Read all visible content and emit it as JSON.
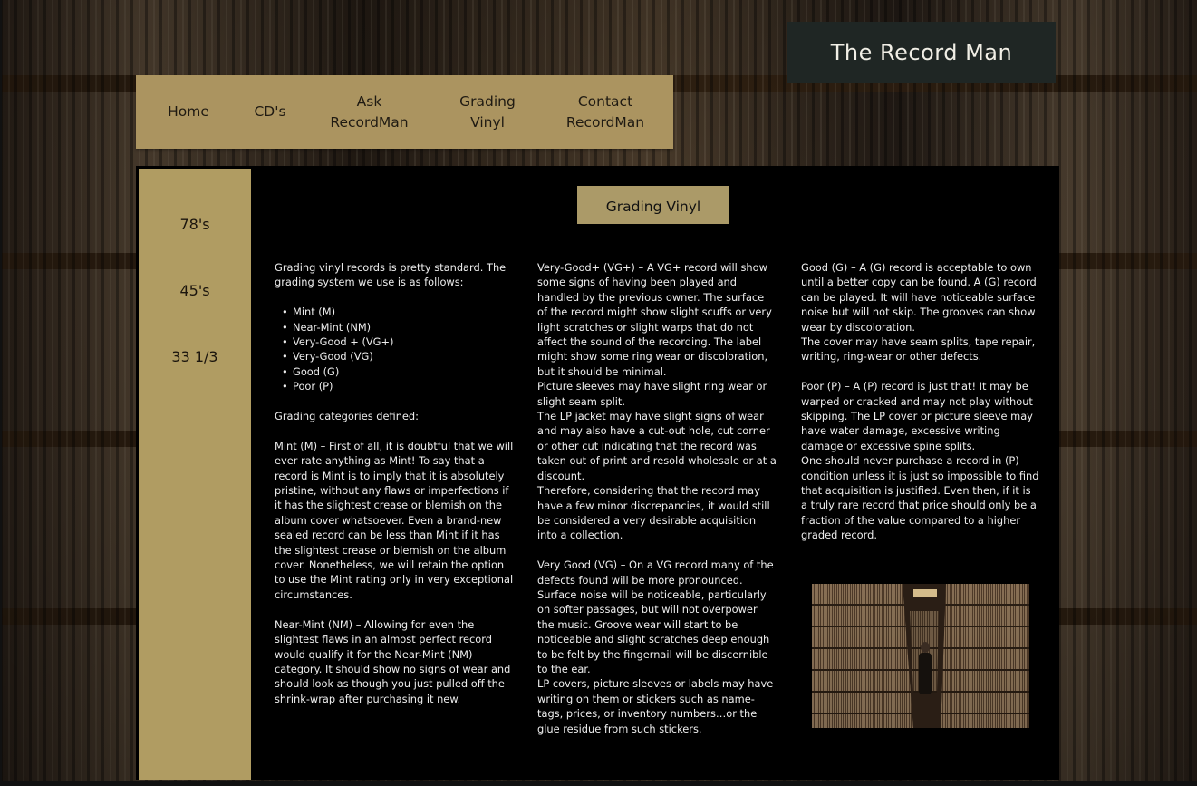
{
  "site": {
    "title": "The Record Man"
  },
  "nav": {
    "items": [
      {
        "label": "Home"
      },
      {
        "label": "CD's"
      },
      {
        "label": "Ask RecordMan"
      },
      {
        "label": "Grading Vinyl"
      },
      {
        "label": "Contact RecordMan"
      }
    ]
  },
  "sidebar": {
    "items": [
      {
        "label": "78's"
      },
      {
        "label": "45's"
      },
      {
        "label": "33 1/3"
      }
    ]
  },
  "main": {
    "heading": "Grading Vinyl",
    "col1": {
      "intro": "Grading vinyl records is pretty standard.  The grading system we use is as follows:",
      "grades": [
        "Mint  (M)",
        "Near-Mint (NM)",
        "Very-Good + (VG+)",
        "Very-Good (VG)",
        "Good (G)",
        "Poor (P)"
      ],
      "defined": "Grading categories defined:",
      "mint": "Mint (M) – First of all, it is doubtful that we will ever rate anything as Mint!  To say that a record is Mint is to imply that it is absolutely pristine, without any flaws or imperfections if it has the slightest crease or blemish on the album cover whatsoever.  Even a brand-new sealed record can be less than Mint if it has the slightest crease or blemish on the album cover.  Nonetheless, we will retain the option to use the Mint rating only in very exceptional circumstances.",
      "near_mint": "Near-Mint (NM) – Allowing for even the slightest flaws in an almost perfect record would qualify it for the Near-Mint (NM) category.  It should show no signs of wear and should look as though you just pulled off the shrink-wrap after purchasing it new."
    },
    "col2": {
      "vg_plus": "Very-Good+ (VG+) – A VG+ record will show some signs of having been played and handled by the previous owner.  The surface of the record might show slight scuffs or very light scratches or slight warps that do not affect the sound of the recording.  The label might show some ring wear or discoloration, but it should be minimal.",
      "sleeves": "Picture sleeves may have slight ring wear or slight seam split.",
      "jacket": "The LP jacket may have slight signs of wear and may also have a cut-out hole, cut corner or other cut indicating that the record was taken out of print and resold wholesale or at a discount.",
      "therefore": "Therefore, considering that the record may have a few minor discrepancies, it would still be considered a very desirable acquisition into a collection.",
      "vg": "Very Good (VG) – On a VG record many of the defects found will be more pronounced.  Surface noise will be noticeable, particularly on softer passages, but will not overpower the music.  Groove wear will start to be noticeable and slight scratches deep enough to be felt by the fingernail will be discernible to the ear.",
      "lp_covers": "LP covers, picture sleeves or labels may have writing on them or stickers such as name-tags, prices, or inventory numbers…or the glue residue from such stickers."
    },
    "col3": {
      "good": "Good (G) – A (G) record is acceptable to own until a better copy can be found.  A (G) record can be played.  It will have noticeable surface noise but will not skip.  The grooves can show wear by discoloration.",
      "good_cover": "The cover may have seam splits, tape repair, writing, ring-wear or other defects.",
      "poor": "Poor (P) – A (P) record is just that!  It may be warped or cracked and may not play without skipping.  The LP cover or picture sleeve may have water damage, excessive writing damage or excessive spine splits.",
      "poor_note": "One should never purchase a record in (P) condition unless it is just so impossible to find that acquisition is justified.  Even then, if it is a truly rare record that price should only be a fraction of the value compared to a higher graded record."
    }
  }
}
